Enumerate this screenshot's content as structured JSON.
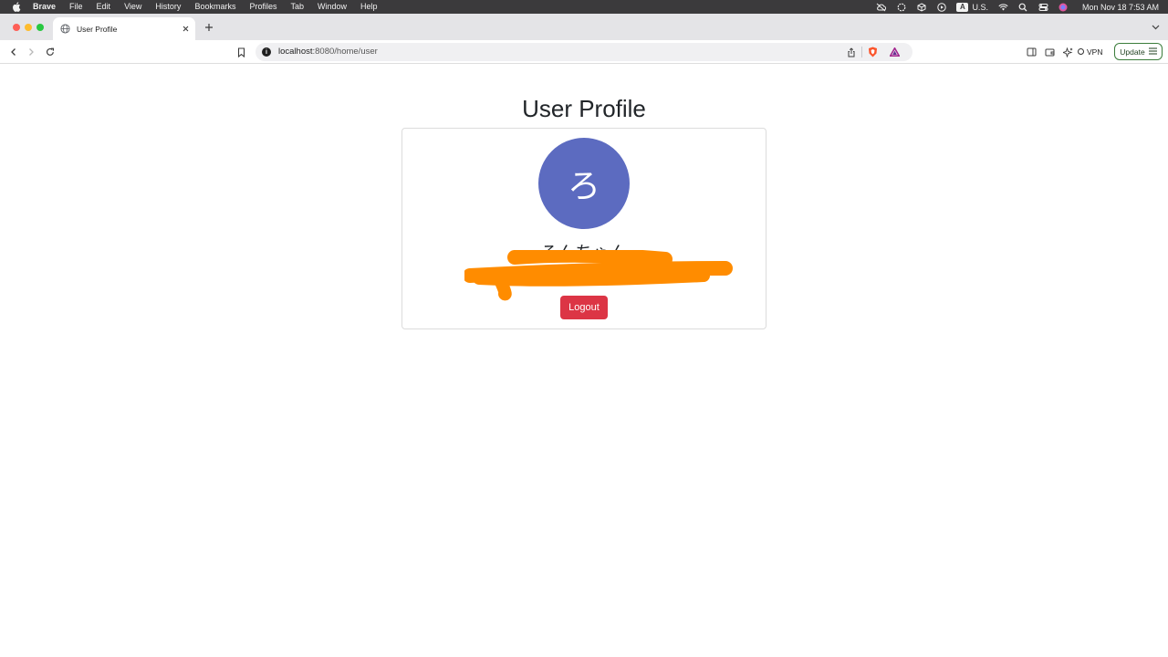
{
  "menubar": {
    "app_name": "Brave",
    "items": [
      "File",
      "Edit",
      "View",
      "History",
      "Bookmarks",
      "Profiles",
      "Tab",
      "Window",
      "Help"
    ],
    "input_source": "U.S.",
    "input_badge": "A",
    "clock": "Mon Nov 18  7:53 AM"
  },
  "browser": {
    "tab_title": "User Profile",
    "url_host": "localhost",
    "url_rest": ":8080/home/user",
    "vpn_label": "VPN",
    "update_label": "Update"
  },
  "page": {
    "title": "User Profile",
    "avatar_initial": "ろ",
    "username": "ろんちゃん",
    "logout_label": "Logout",
    "colors": {
      "avatar_bg": "#5c6bc0",
      "logout_bg": "#dc3545",
      "redaction": "#ff8c00"
    }
  }
}
